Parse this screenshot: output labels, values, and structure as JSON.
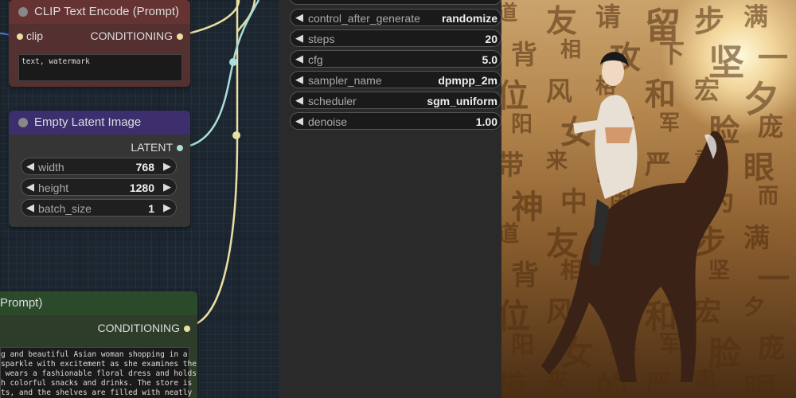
{
  "nodes": {
    "clip_negative": {
      "title": "CLIP Text Encode (Prompt)",
      "input_label": "clip",
      "output_label": "CONDITIONING",
      "text": "text, watermark"
    },
    "empty_latent": {
      "title": "Empty Latent Image",
      "output_label": "LATENT",
      "widgets": [
        {
          "label": "width",
          "value": "768"
        },
        {
          "label": "height",
          "value": "1280"
        },
        {
          "label": "batch_size",
          "value": "1"
        }
      ]
    },
    "clip_positive": {
      "title": "Prompt)",
      "output_label": "CONDITIONING",
      "text_lines": [
        "g and beautiful Asian woman shopping in a",
        "sparkle with excitement as she examines the",
        " wears a fashionable floral dress and holds",
        "h colorful snacks and drinks. The store is",
        "ts, and the shelves are filled with neatly"
      ]
    }
  },
  "ksampler": {
    "widgets": [
      {
        "label": "control_after_generate",
        "value": "randomize"
      },
      {
        "label": "steps",
        "value": "20"
      },
      {
        "label": "cfg",
        "value": "5.0"
      },
      {
        "label": "sampler_name",
        "value": "dpmpp_2m"
      },
      {
        "label": "scheduler",
        "value": "sgm_uniform"
      },
      {
        "label": "denoise",
        "value": "1.00"
      }
    ]
  },
  "preview": {
    "glyphs": [
      "道",
      "友",
      "请",
      "留",
      "步",
      "满",
      "背",
      "相",
      "攻",
      "下",
      "坚",
      "一",
      "位",
      "风",
      "格",
      "和",
      "宏",
      "夕",
      "阳",
      "女",
      "将",
      "军",
      "脸",
      "庞",
      "带",
      "来",
      "的",
      "严",
      "肃",
      "眼",
      "神",
      "中",
      "国",
      "作",
      "为",
      "而"
    ]
  },
  "colors": {
    "clip_node_title": "#663333",
    "clip_node_body": "#553030",
    "latent_node_title": "#3d2f6e",
    "latent_node_body": "#353535",
    "positive_node_title": "#2a4a2a",
    "positive_node_body": "#2d3d2a",
    "wire_clip": "#e9dfa2",
    "wire_latent": "#a8ddd8"
  }
}
